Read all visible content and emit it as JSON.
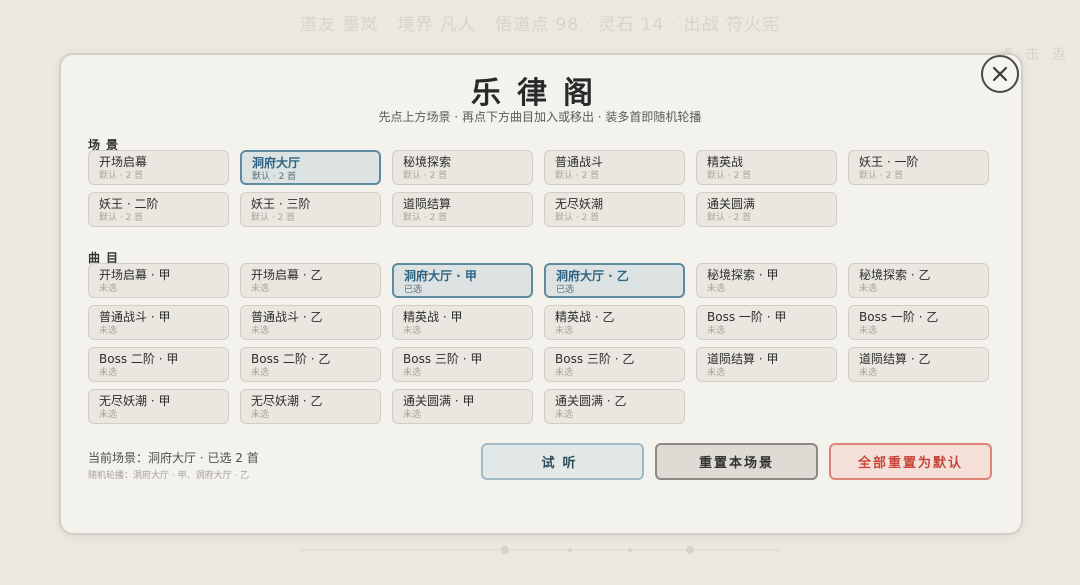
{
  "background": {
    "status_text": "道友 墨岚 · 境界 凡人 · 悟道点 98 · 灵石 14 · 出战 符火宪",
    "side_text": "点 击 返"
  },
  "modal": {
    "title": "乐律阁",
    "subtitle": "先点上方场景 · 再点下方曲目加入或移出 · 装多首即随机轮播",
    "close_icon": "close-icon"
  },
  "scenes": {
    "label": "场景",
    "items": [
      {
        "name": "开场启幕",
        "sub": "默认 · 2 首",
        "selected": false
      },
      {
        "name": "洞府大厅",
        "sub": "默认 · 2 首",
        "selected": true
      },
      {
        "name": "秘境探索",
        "sub": "默认 · 2 首",
        "selected": false
      },
      {
        "name": "普通战斗",
        "sub": "默认 · 2 首",
        "selected": false
      },
      {
        "name": "精英战",
        "sub": "默认 · 2 首",
        "selected": false
      },
      {
        "name": "妖王 · 一阶",
        "sub": "默认 · 2 首",
        "selected": false
      },
      {
        "name": "妖王 · 二阶",
        "sub": "默认 · 2 首",
        "selected": false
      },
      {
        "name": "妖王 · 三阶",
        "sub": "默认 · 2 首",
        "selected": false
      },
      {
        "name": "道陨结算",
        "sub": "默认 · 2 首",
        "selected": false
      },
      {
        "name": "无尽妖潮",
        "sub": "默认 · 2 首",
        "selected": false
      },
      {
        "name": "通关圆满",
        "sub": "默认 · 2 首",
        "selected": false
      }
    ]
  },
  "tracks": {
    "label": "曲目",
    "items": [
      {
        "name": "开场启幕 · 甲",
        "sub": "未选",
        "selected": false
      },
      {
        "name": "开场启幕 · 乙",
        "sub": "未选",
        "selected": false
      },
      {
        "name": "洞府大厅 · 甲",
        "sub": "已选",
        "selected": true
      },
      {
        "name": "洞府大厅 · 乙",
        "sub": "已选",
        "selected": true
      },
      {
        "name": "秘境探索 · 甲",
        "sub": "未选",
        "selected": false
      },
      {
        "name": "秘境探索 · 乙",
        "sub": "未选",
        "selected": false
      },
      {
        "name": "普通战斗 · 甲",
        "sub": "未选",
        "selected": false
      },
      {
        "name": "普通战斗 · 乙",
        "sub": "未选",
        "selected": false
      },
      {
        "name": "精英战 · 甲",
        "sub": "未选",
        "selected": false
      },
      {
        "name": "精英战 · 乙",
        "sub": "未选",
        "selected": false
      },
      {
        "name": "Boss 一阶 · 甲",
        "sub": "未选",
        "selected": false
      },
      {
        "name": "Boss 一阶 · 乙",
        "sub": "未选",
        "selected": false
      },
      {
        "name": "Boss 二阶 · 甲",
        "sub": "未选",
        "selected": false
      },
      {
        "name": "Boss 二阶 · 乙",
        "sub": "未选",
        "selected": false
      },
      {
        "name": "Boss 三阶 · 甲",
        "sub": "未选",
        "selected": false
      },
      {
        "name": "Boss 三阶 · 乙",
        "sub": "未选",
        "selected": false
      },
      {
        "name": "道陨结算 · 甲",
        "sub": "未选",
        "selected": false
      },
      {
        "name": "道陨结算 · 乙",
        "sub": "未选",
        "selected": false
      },
      {
        "name": "无尽妖潮 · 甲",
        "sub": "未选",
        "selected": false
      },
      {
        "name": "无尽妖潮 · 乙",
        "sub": "未选",
        "selected": false
      },
      {
        "name": "通关圆满 · 甲",
        "sub": "未选",
        "selected": false
      },
      {
        "name": "通关圆满 · 乙",
        "sub": "未选",
        "selected": false
      }
    ]
  },
  "status": {
    "current": "当前场景：洞府大厅 · 已选 2 首",
    "playlist": "随机轮播：洞府大厅 · 甲、洞府大厅 · 乙"
  },
  "buttons": {
    "listen": "试听",
    "reset_scene": "重置本场景",
    "reset_all": "全部重置为默认"
  },
  "colors": {
    "accent": "#5e8aa0",
    "danger": "#c8473a",
    "panel": "#f4f2ed"
  }
}
